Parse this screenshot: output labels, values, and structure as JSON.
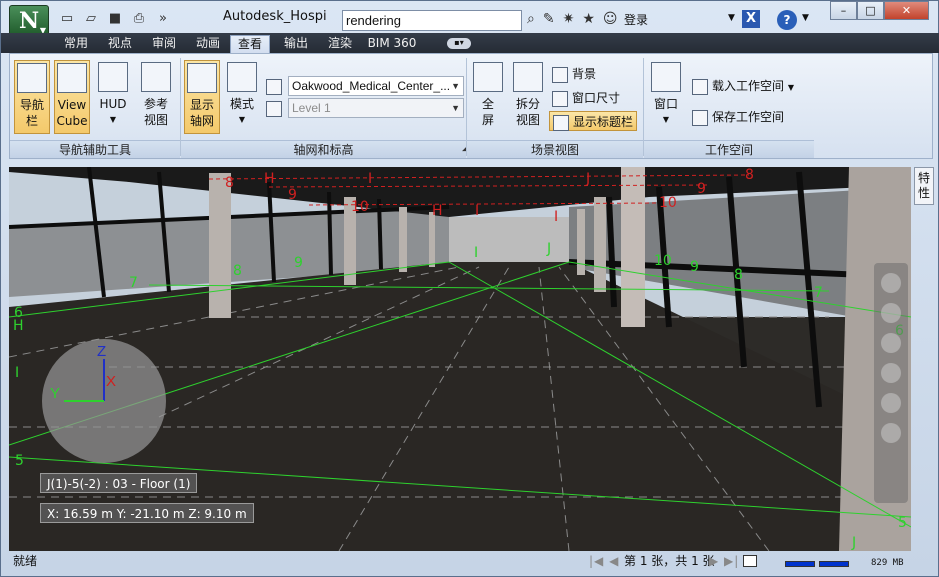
{
  "titlebar": {
    "app_logo": "N",
    "title": "Autodesk_Hospi",
    "search_value": "rendering",
    "login_label": "登录",
    "icons": [
      "save-icon",
      "open-icon",
      "print-icon",
      "binoculars-icon",
      "wrench-icon",
      "star-icon",
      "user-icon",
      "exchange-icon",
      "help-icon"
    ]
  },
  "tabs": [
    "常用",
    "视点",
    "审阅",
    "动画",
    "查看",
    "输出",
    "渲染",
    "BIM 360"
  ],
  "active_tab": "查看",
  "ribbon": {
    "nav_panel": {
      "title": "导航辅助工具",
      "btn_navbar": "导航\n栏",
      "btn_viewcube": "View\nCube",
      "btn_hud": "HUD",
      "btn_reference": "参考\n视图"
    },
    "grid_panel": {
      "title": "轴网和标高",
      "btn_show_grid": "显示\n轴网",
      "btn_mode": "模式",
      "model_dropdown": "Oakwood_Medical_Center_...",
      "level_dropdown": "Level 1"
    },
    "scene_panel": {
      "title": "场景视图",
      "btn_fullscreen": "全\n屏",
      "btn_split": "拆分\n视图",
      "item_background": "背景",
      "item_window_size": "窗口尺寸",
      "item_show_titlebar": "显示标题栏"
    },
    "workspace_panel": {
      "title": "工作空间",
      "btn_window": "窗口",
      "item_load": "载入工作空间",
      "item_save": "保存工作空间"
    }
  },
  "viewport": {
    "properties_tab": "特性",
    "axis": {
      "z": "Z",
      "y": "Y",
      "x": "X"
    },
    "grid_location": "J(1)-5(-2) : 03 - Floor (1)",
    "coords": "X: 16.59 m  Y: -21.10 m  Z: 9.10 m",
    "grid_labels_red": [
      "8",
      "H",
      "9",
      "I",
      "J",
      "9",
      "10",
      "H",
      "I",
      "10",
      "8",
      "I"
    ],
    "grid_labels_green": [
      "7",
      "8",
      "9",
      "I",
      "J",
      "10",
      "9",
      "8",
      "7",
      "6",
      "H",
      "I",
      "5",
      "5",
      "J",
      "6"
    ]
  },
  "statusbar": {
    "status": "就绪",
    "page": "第 1 张，共 1 张",
    "memory": "829 MB"
  },
  "colors": {
    "accent_green": "#1f8f2f",
    "grid_red": "#d02020",
    "grid_green": "#2ed12e",
    "tab_bar": "#2c333e"
  }
}
